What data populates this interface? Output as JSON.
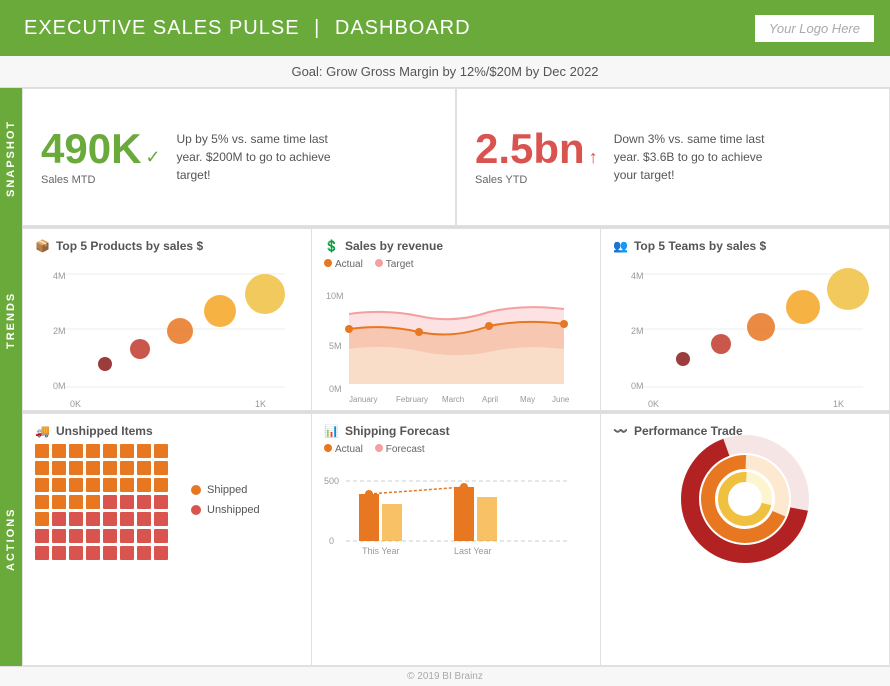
{
  "header": {
    "title": "EXECUTIVE SALES PULSE",
    "separator": "|",
    "subtitle": "DASHBOARD",
    "logo": "Your Logo Here"
  },
  "goal_bar": {
    "text": "Goal: Grow Gross Margin by 12%/$20M by Dec 2022"
  },
  "snapshot": {
    "label": "SNAPSHOT",
    "card1": {
      "number": "490K",
      "suffix": "✓",
      "sub": "Sales MTD",
      "desc": "Up by 5% vs. same time last year. $200M to go to achieve target!"
    },
    "card2": {
      "number": "2.5bn",
      "suffix": "↑",
      "sub": "Sales YTD",
      "desc": "Down 3% vs. same time last year. $3.6B to go to achieve your target!"
    }
  },
  "trends": {
    "label": "TRENDS",
    "card1": {
      "icon": "📦",
      "title": "Top 5 Products by sales $"
    },
    "card2": {
      "icon": "💲",
      "title": "Sales by revenue",
      "legend": [
        "Actual",
        "Target"
      ]
    },
    "card3": {
      "icon": "👥",
      "title": "Top 5 Teams by sales $"
    }
  },
  "actions": {
    "label": "ACTIONS",
    "card1": {
      "icon": "🚚",
      "title": "Unshipped Items",
      "legend": [
        "Shipped",
        "Unshipped"
      ]
    },
    "card2": {
      "icon": "📊",
      "title": "Shipping Forecast",
      "legend": [
        "Actual",
        "Forecast"
      ]
    },
    "card3": {
      "icon": "📈",
      "title": "Performance Trade"
    }
  },
  "footer": {
    "text": "© 2019 BI Brainz"
  },
  "colors": {
    "green": "#6aaa3a",
    "red": "#d9534f",
    "orange": "#e87722",
    "light_orange": "#f5a623",
    "pink": "#f4a0a0",
    "light_pink": "#fbd5d5",
    "dark_red": "#b22222",
    "yellow_orange": "#f0c040"
  }
}
